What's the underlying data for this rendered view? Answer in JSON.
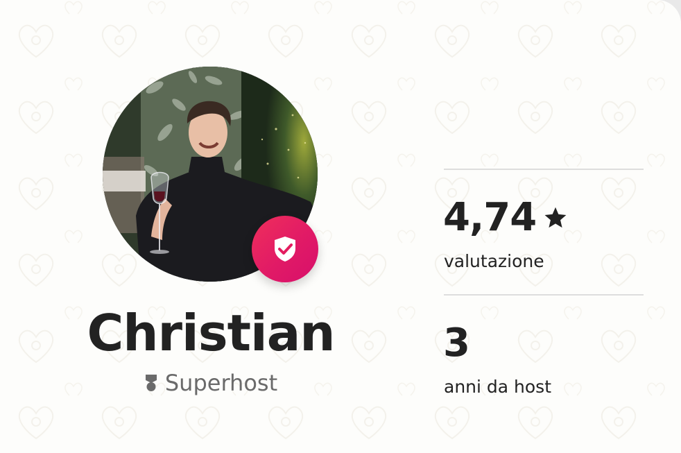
{
  "host": {
    "name": "Christian",
    "superhost_label": "Superhost",
    "verified": true
  },
  "stats": [
    {
      "value": "4,74",
      "label": "valutazione",
      "icon": "star-icon"
    },
    {
      "value": "3",
      "label": "anni da host"
    }
  ],
  "colors": {
    "card_background": "#fdfdfb",
    "text_primary": "#222222",
    "text_secondary": "#6a6a6a",
    "divider": "#dddddd",
    "badge_accent": "#e31c5f"
  },
  "icons": {
    "verified_badge": "shield-check-icon",
    "superhost": "medal-icon",
    "rating": "star-icon",
    "background_pattern": "airbnb-logo-pattern"
  }
}
